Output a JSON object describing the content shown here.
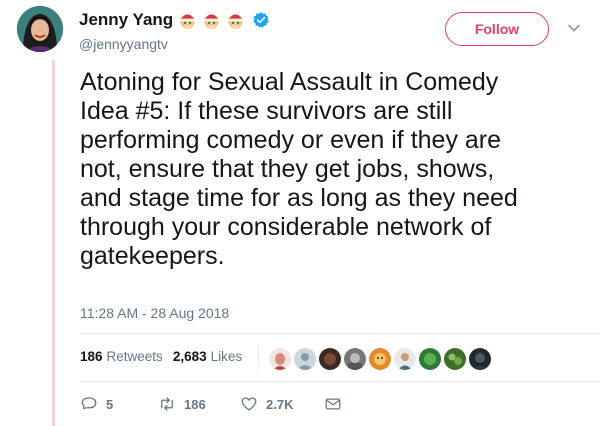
{
  "user": {
    "display_name": "Jenny Yang",
    "handle": "@jennyyangtv",
    "emojis": [
      "santa-face-emoji",
      "santa-face-emoji",
      "santa-face-emoji"
    ],
    "verified_icon": "verified-badge-icon"
  },
  "follow_button": {
    "label": "Follow",
    "color": "#ea3f62"
  },
  "tweet": {
    "text": "Atoning for Sexual Assault in Comedy\nIdea #5: If these survivors are still\nperforming comedy or even if they are\nnot, ensure that they get jobs, shows,\nand stage time for as long as they need\nthrough your considerable network of\ngatekeepers.",
    "timestamp": "11:28 AM - 28 Aug 2018"
  },
  "stats": {
    "retweets_count": "186",
    "retweets_label": "Retweets",
    "likes_count": "2,683",
    "likes_label": "Likes"
  },
  "actions": {
    "reply_count": "5",
    "retweet_count": "186",
    "like_count": "2.7K"
  },
  "colors": {
    "thread_line": "#fbcfd7",
    "secondary_text": "#657786",
    "verified": "#1da1f2"
  }
}
